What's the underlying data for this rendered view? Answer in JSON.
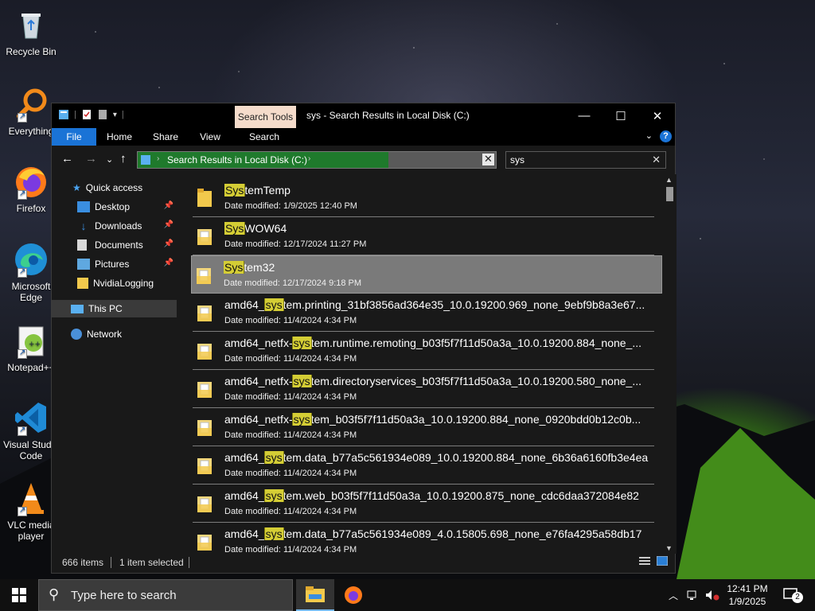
{
  "desktop": {
    "icons": [
      {
        "label": "Recycle Bin"
      },
      {
        "label": "Everything"
      },
      {
        "label": "Firefox"
      },
      {
        "label": "Microsoft Edge"
      },
      {
        "label": "Notepad++"
      },
      {
        "label": "Visual Studio Code"
      },
      {
        "label": "VLC media player"
      }
    ]
  },
  "window": {
    "title": "sys - Search Results in Local Disk (C:)",
    "contextual_tab": "Search Tools",
    "ribbon_tabs": [
      "File",
      "Home",
      "Share",
      "View",
      "Search"
    ],
    "controls": {
      "minimize": "—",
      "maximize": "☐",
      "close": "✕"
    },
    "address": {
      "path": "Search Results in Local Disk (C:)",
      "progress_fraction": 0.7
    },
    "search": {
      "value": "sys"
    },
    "sidebar": {
      "quick_access": "Quick access",
      "pinned": [
        "Desktop",
        "Downloads",
        "Documents",
        "Pictures"
      ],
      "other": "NvidiaLogging",
      "this_pc": "This PC",
      "network": "Network"
    },
    "results": [
      {
        "pre": "",
        "hl": "Sys",
        "post": "temTemp",
        "date": "Date modified: 1/9/2025 12:40 PM",
        "type": "folder"
      },
      {
        "pre": "",
        "hl": "Sys",
        "post": "WOW64",
        "date": "Date modified: 12/17/2024 11:27 PM",
        "type": "folder-doc"
      },
      {
        "pre": "",
        "hl": "Sys",
        "post": "tem32",
        "date": "Date modified: 12/17/2024 9:18 PM",
        "type": "folder-doc"
      },
      {
        "pre": "amd64_",
        "hl": "sys",
        "post": "tem.printing_31bf3856ad364e35_10.0.19200.969_none_9ebf9b8a3e67...",
        "date": "Date modified: 11/4/2024 4:34 PM",
        "type": "folder-doc"
      },
      {
        "pre": "amd64_netfx-",
        "hl": "sys",
        "post": "tem.runtime.remoting_b03f5f7f11d50a3a_10.0.19200.884_none_...",
        "date": "Date modified: 11/4/2024 4:34 PM",
        "type": "folder-doc"
      },
      {
        "pre": "amd64_netfx-",
        "hl": "sys",
        "post": "tem.directoryservices_b03f5f7f11d50a3a_10.0.19200.580_none_...",
        "date": "Date modified: 11/4/2024 4:34 PM",
        "type": "folder-doc"
      },
      {
        "pre": "amd64_netfx-",
        "hl": "sys",
        "post": "tem_b03f5f7f11d50a3a_10.0.19200.884_none_0920bdd0b12c0b...",
        "date": "Date modified: 11/4/2024 4:34 PM",
        "type": "folder-doc"
      },
      {
        "pre": "amd64_",
        "hl": "sys",
        "post": "tem.data_b77a5c561934e089_10.0.19200.884_none_6b36a6160fb3e4ea",
        "date": "Date modified: 11/4/2024 4:34 PM",
        "type": "folder-doc"
      },
      {
        "pre": "amd64_",
        "hl": "sys",
        "post": "tem.web_b03f5f7f11d50a3a_10.0.19200.875_none_cdc6daa372084e82",
        "date": "Date modified: 11/4/2024 4:34 PM",
        "type": "folder-doc"
      },
      {
        "pre": "amd64_",
        "hl": "sys",
        "post": "tem.data_b77a5c561934e089_4.0.15805.698_none_e76fa4295a58db17",
        "date": "Date modified: 11/4/2024 4:34 PM",
        "type": "folder-doc"
      }
    ],
    "selected_index": 2,
    "status": {
      "count": "666 items",
      "selection": "1 item selected"
    }
  },
  "taskbar": {
    "search_placeholder": "Type here to search",
    "time": "12:41 PM",
    "date": "1/9/2025",
    "notification_count": "2"
  },
  "colors": {
    "accent": "#1a73d6",
    "highlight": "#d4cd35",
    "search_tools_tab": "#f5dccb",
    "progress": "#1f7a2c"
  }
}
